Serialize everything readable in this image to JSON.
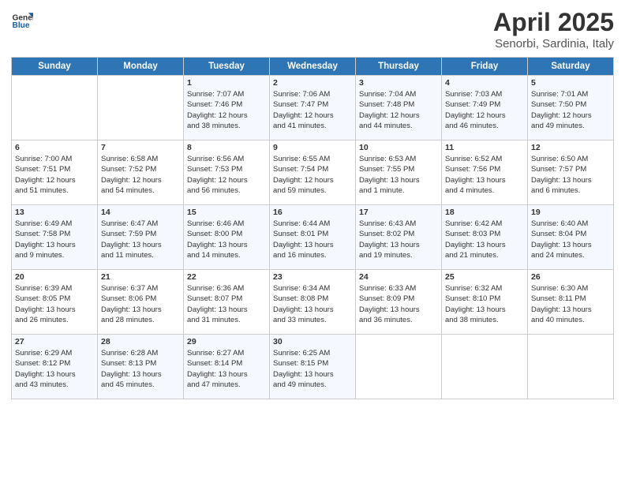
{
  "logo": {
    "line1": "General",
    "line2": "Blue"
  },
  "title": "April 2025",
  "subtitle": "Senorbi, Sardinia, Italy",
  "days_header": [
    "Sunday",
    "Monday",
    "Tuesday",
    "Wednesday",
    "Thursday",
    "Friday",
    "Saturday"
  ],
  "weeks": [
    [
      {
        "day": "",
        "content": ""
      },
      {
        "day": "",
        "content": ""
      },
      {
        "day": "1",
        "content": "Sunrise: 7:07 AM\nSunset: 7:46 PM\nDaylight: 12 hours\nand 38 minutes."
      },
      {
        "day": "2",
        "content": "Sunrise: 7:06 AM\nSunset: 7:47 PM\nDaylight: 12 hours\nand 41 minutes."
      },
      {
        "day": "3",
        "content": "Sunrise: 7:04 AM\nSunset: 7:48 PM\nDaylight: 12 hours\nand 44 minutes."
      },
      {
        "day": "4",
        "content": "Sunrise: 7:03 AM\nSunset: 7:49 PM\nDaylight: 12 hours\nand 46 minutes."
      },
      {
        "day": "5",
        "content": "Sunrise: 7:01 AM\nSunset: 7:50 PM\nDaylight: 12 hours\nand 49 minutes."
      }
    ],
    [
      {
        "day": "6",
        "content": "Sunrise: 7:00 AM\nSunset: 7:51 PM\nDaylight: 12 hours\nand 51 minutes."
      },
      {
        "day": "7",
        "content": "Sunrise: 6:58 AM\nSunset: 7:52 PM\nDaylight: 12 hours\nand 54 minutes."
      },
      {
        "day": "8",
        "content": "Sunrise: 6:56 AM\nSunset: 7:53 PM\nDaylight: 12 hours\nand 56 minutes."
      },
      {
        "day": "9",
        "content": "Sunrise: 6:55 AM\nSunset: 7:54 PM\nDaylight: 12 hours\nand 59 minutes."
      },
      {
        "day": "10",
        "content": "Sunrise: 6:53 AM\nSunset: 7:55 PM\nDaylight: 13 hours\nand 1 minute."
      },
      {
        "day": "11",
        "content": "Sunrise: 6:52 AM\nSunset: 7:56 PM\nDaylight: 13 hours\nand 4 minutes."
      },
      {
        "day": "12",
        "content": "Sunrise: 6:50 AM\nSunset: 7:57 PM\nDaylight: 13 hours\nand 6 minutes."
      }
    ],
    [
      {
        "day": "13",
        "content": "Sunrise: 6:49 AM\nSunset: 7:58 PM\nDaylight: 13 hours\nand 9 minutes."
      },
      {
        "day": "14",
        "content": "Sunrise: 6:47 AM\nSunset: 7:59 PM\nDaylight: 13 hours\nand 11 minutes."
      },
      {
        "day": "15",
        "content": "Sunrise: 6:46 AM\nSunset: 8:00 PM\nDaylight: 13 hours\nand 14 minutes."
      },
      {
        "day": "16",
        "content": "Sunrise: 6:44 AM\nSunset: 8:01 PM\nDaylight: 13 hours\nand 16 minutes."
      },
      {
        "day": "17",
        "content": "Sunrise: 6:43 AM\nSunset: 8:02 PM\nDaylight: 13 hours\nand 19 minutes."
      },
      {
        "day": "18",
        "content": "Sunrise: 6:42 AM\nSunset: 8:03 PM\nDaylight: 13 hours\nand 21 minutes."
      },
      {
        "day": "19",
        "content": "Sunrise: 6:40 AM\nSunset: 8:04 PM\nDaylight: 13 hours\nand 24 minutes."
      }
    ],
    [
      {
        "day": "20",
        "content": "Sunrise: 6:39 AM\nSunset: 8:05 PM\nDaylight: 13 hours\nand 26 minutes."
      },
      {
        "day": "21",
        "content": "Sunrise: 6:37 AM\nSunset: 8:06 PM\nDaylight: 13 hours\nand 28 minutes."
      },
      {
        "day": "22",
        "content": "Sunrise: 6:36 AM\nSunset: 8:07 PM\nDaylight: 13 hours\nand 31 minutes."
      },
      {
        "day": "23",
        "content": "Sunrise: 6:34 AM\nSunset: 8:08 PM\nDaylight: 13 hours\nand 33 minutes."
      },
      {
        "day": "24",
        "content": "Sunrise: 6:33 AM\nSunset: 8:09 PM\nDaylight: 13 hours\nand 36 minutes."
      },
      {
        "day": "25",
        "content": "Sunrise: 6:32 AM\nSunset: 8:10 PM\nDaylight: 13 hours\nand 38 minutes."
      },
      {
        "day": "26",
        "content": "Sunrise: 6:30 AM\nSunset: 8:11 PM\nDaylight: 13 hours\nand 40 minutes."
      }
    ],
    [
      {
        "day": "27",
        "content": "Sunrise: 6:29 AM\nSunset: 8:12 PM\nDaylight: 13 hours\nand 43 minutes."
      },
      {
        "day": "28",
        "content": "Sunrise: 6:28 AM\nSunset: 8:13 PM\nDaylight: 13 hours\nand 45 minutes."
      },
      {
        "day": "29",
        "content": "Sunrise: 6:27 AM\nSunset: 8:14 PM\nDaylight: 13 hours\nand 47 minutes."
      },
      {
        "day": "30",
        "content": "Sunrise: 6:25 AM\nSunset: 8:15 PM\nDaylight: 13 hours\nand 49 minutes."
      },
      {
        "day": "",
        "content": ""
      },
      {
        "day": "",
        "content": ""
      },
      {
        "day": "",
        "content": ""
      }
    ]
  ]
}
